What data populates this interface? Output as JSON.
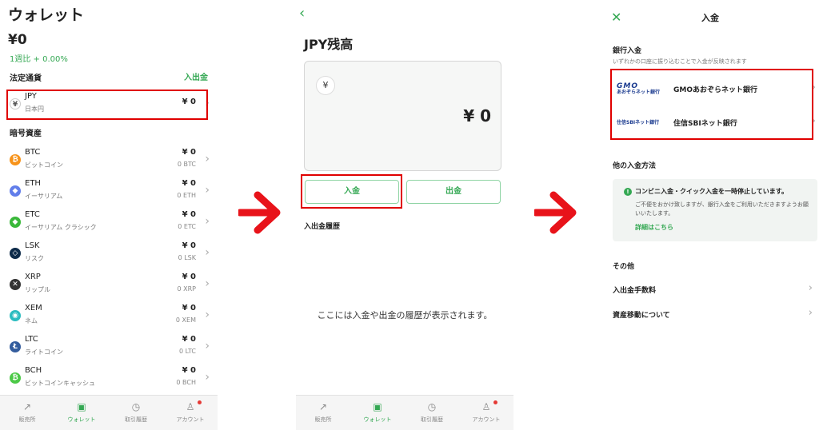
{
  "wallet": {
    "title": "ウォレット",
    "balance": "¥0",
    "weekly_change": "1週比 + 0.00%",
    "fiat_header": "法定通貨",
    "deposit_withdraw_link": "入出金",
    "crypto_header": "暗号資産",
    "jpy": {
      "symbol": "JPY",
      "name": "日本円",
      "amount": "¥ 0",
      "icon": "¥"
    },
    "assets": [
      {
        "symbol": "BTC",
        "name": "ビットコイン",
        "amount": "¥ 0",
        "sub": "0 BTC",
        "icon": "bitcoin-icon",
        "color": "#f7931a",
        "glyph": "₿"
      },
      {
        "symbol": "ETH",
        "name": "イーサリアム",
        "amount": "¥ 0",
        "sub": "0 ETH",
        "icon": "ethereum-icon",
        "color": "#627eea",
        "glyph": "◆"
      },
      {
        "symbol": "ETC",
        "name": "イーサリアム クラシック",
        "amount": "¥ 0",
        "sub": "0 ETC",
        "icon": "ethereum-classic-icon",
        "color": "#3ab83a",
        "glyph": "◆"
      },
      {
        "symbol": "LSK",
        "name": "リスク",
        "amount": "¥ 0",
        "sub": "0 LSK",
        "icon": "lisk-icon",
        "color": "#0d2b4a",
        "glyph": "◇"
      },
      {
        "symbol": "XRP",
        "name": "リップル",
        "amount": "¥ 0",
        "sub": "0 XRP",
        "icon": "ripple-icon",
        "color": "#333333",
        "glyph": "✕"
      },
      {
        "symbol": "XEM",
        "name": "ネム",
        "amount": "¥ 0",
        "sub": "0 XEM",
        "icon": "nem-icon",
        "color": "#2bbcc0",
        "glyph": "◉"
      },
      {
        "symbol": "LTC",
        "name": "ライトコイン",
        "amount": "¥ 0",
        "sub": "0 LTC",
        "icon": "litecoin-icon",
        "color": "#345d9d",
        "glyph": "Ł"
      },
      {
        "symbol": "BCH",
        "name": "ビットコインキャッシュ",
        "amount": "¥ 0",
        "sub": "0 BCH",
        "icon": "bitcoin-cash-icon",
        "color": "#4cc947",
        "glyph": "₿"
      }
    ]
  },
  "tabs": [
    {
      "label": "販売所",
      "icon": "chart-icon",
      "glyph": "↗"
    },
    {
      "label": "ウォレット",
      "icon": "wallet-icon",
      "glyph": "▣"
    },
    {
      "label": "取引履歴",
      "icon": "history-icon",
      "glyph": "◷"
    },
    {
      "label": "アカウント",
      "icon": "account-icon",
      "glyph": "♙"
    }
  ],
  "active_tab": 1,
  "jpy_balance": {
    "back_glyph": "‹",
    "title": "JPY残高",
    "yen_glyph": "¥",
    "amount": "¥ 0",
    "deposit_button": "入金",
    "withdraw_button": "出金",
    "history_header": "入出金履歴",
    "history_empty": "ここには入金や出金の履歴が表示されます。"
  },
  "deposit": {
    "close_glyph": "✕",
    "title": "入金",
    "bank_header": "銀行入金",
    "bank_desc": "いずれかの口座に振り込むことで入金が反映されます",
    "banks": [
      {
        "logo_big": "GMO",
        "logo_small": "あおぞらネット銀行",
        "name": "GMOあおぞらネット銀行"
      },
      {
        "logo_big": "",
        "logo_small": "住信SBIネット銀行",
        "name": "住信SBIネット銀行"
      }
    ],
    "other_header": "他の入金方法",
    "notice_title": "コンビニ入金・クイック入金を一時停止しています。",
    "notice_body": "ご不便をおかけ致しますが、銀行入金をご利用いただきますようお願いいたします。",
    "notice_link": "詳細はこちら",
    "misc_header": "その他",
    "links": [
      "入出金手数料",
      "資産移動について"
    ]
  },
  "colors": {
    "accent": "#34a853",
    "highlight": "#e00000",
    "arrow": "#e8131a"
  }
}
